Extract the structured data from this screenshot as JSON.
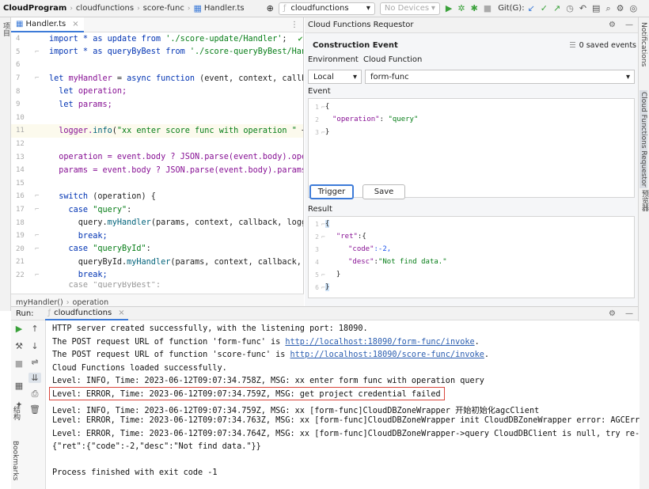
{
  "topbar": {
    "project": "CloudProgram",
    "crumbs": [
      "cloudfunctions",
      "score-func",
      "Handler.ts"
    ],
    "function_selector": "cloudfunctions",
    "devices": "No Devices",
    "git_label": "Git(G):"
  },
  "left_strip": {
    "label": "项目"
  },
  "right_strip": {
    "notifications": "Notifications",
    "requestor": "Cloud Functions Requestor",
    "preview": "预览器"
  },
  "editor": {
    "tab": "Handler.ts",
    "lines": [
      {
        "n": "4"
      },
      {
        "n": "5"
      },
      {
        "n": "6"
      },
      {
        "n": "7"
      },
      {
        "n": "8"
      },
      {
        "n": "9"
      },
      {
        "n": "10"
      },
      {
        "n": "11"
      },
      {
        "n": "12"
      },
      {
        "n": "13"
      },
      {
        "n": "14"
      },
      {
        "n": "15"
      },
      {
        "n": "16"
      },
      {
        "n": "17"
      },
      {
        "n": "18"
      },
      {
        "n": "19"
      },
      {
        "n": "20"
      },
      {
        "n": "21"
      },
      {
        "n": "22"
      }
    ],
    "code": {
      "l4a": "import * as update from ",
      "l4b": "'./score-update/Handler'",
      "l5a": "import * as queryByBest from ",
      "l5b": "'./score-queryByBest/Han",
      "l7a": "let ",
      "l7b": "myHandler",
      "l7c": " = ",
      "l7d": "async function",
      "l7e": " (event, context, callb",
      "l8a": "  let ",
      "l8b": "operation;",
      "l9a": "  let ",
      "l9b": "params;",
      "l11a": "  logger.",
      "l11b": "info",
      "l11c": "(",
      "l11d": "\"xx enter score func with operation \"",
      "l11e": " +",
      "l13": "  operation = event.body ? JSON.parse(event.body).ope",
      "l14": "  params = event.body ? JSON.parse(event.body).params",
      "l16a": "  switch ",
      "l16b": "(operation) {",
      "l17a": "    case ",
      "l17b": "\"query\"",
      "l17c": ":",
      "l18a": "      query.",
      "l18b": "myHandler",
      "l18c": "(params, context, callback, logg",
      "l19": "      break;",
      "l20a": "    case ",
      "l20b": "\"queryById\"",
      "l20c": ":",
      "l21a": "      queryById.",
      "l21b": "myHandler",
      "l21c": "(params, context, callback,",
      "l22": "      break;",
      "l23": "    case \"queryByBest\":"
    },
    "breadcrumb": [
      "myHandler()",
      "operation"
    ]
  },
  "cfr": {
    "title": "Cloud Functions Requestor",
    "construction_event": "Construction Event",
    "saved_events": "0 saved events",
    "environment_label": "Environment",
    "cloud_function_label": "Cloud Function",
    "environment_value": "Local",
    "function_value": "form-func",
    "event_label": "Event",
    "event_json": {
      "l1": "{",
      "key": "\"operation\"",
      "colon": ": ",
      "val": "\"query\"",
      "l3": "}"
    },
    "trigger": "Trigger",
    "save": "Save",
    "result_label": "Result",
    "result_json": {
      "l1": "{",
      "l2k": "\"ret\"",
      "l2v": ":{",
      "l3k": "\"code\"",
      "l3v": ":-2,",
      "l4k": "\"desc\"",
      "l4c": ":",
      "l4v": "\"Not find data.\"",
      "l5": "}",
      "l6": "}"
    },
    "line_numbers": [
      "1",
      "2",
      "3",
      "4",
      "5",
      "6"
    ]
  },
  "run": {
    "label": "Run:",
    "tab": "cloudfunctions",
    "console": {
      "c1": "HTTP server created successfully, with the listening port: 18090.",
      "c2a": "The POST request URL of function 'form-func' is ",
      "c2b": "http://localhost:18090/form-func/invoke",
      "c2c": ".",
      "c3a": "The POST request URL of function 'score-func' is ",
      "c3b": "http://localhost:18090/score-func/invoke",
      "c3c": ".",
      "c4": "Cloud Functions loaded successfully.",
      "c5": "Level: INFO, Time: 2023-06-12T09:07:34.758Z, MSG: xx enter form func with operation query",
      "c6": "Level: ERROR, Time: 2023-06-12T09:07:34.759Z, MSG: get project credential failed",
      "c7": "Level: INFO, Time: 2023-06-12T09:07:34.759Z, MSG: xx [form-func]CloudDBZoneWrapper 开始初始化agcClient",
      "c8": "Level: ERROR, Time: 2023-06-12T09:07:34.763Z, MSG: xx [form-func]CloudDBZoneWrapper init CloudDBZoneWrapper error: AGCError",
      "c9": "Level: ERROR, Time: 2023-06-12T09:07:34.764Z, MSG: xx [form-func]CloudDBZoneWrapper->query CloudDBClient is null, try re-in",
      "c10": "{\"ret\":{\"code\":-2,\"desc\":\"Not find data.\"}}",
      "c11": "Process finished with exit code -1"
    },
    "side_labels": {
      "structure": "结构",
      "bookmarks": "Bookmarks"
    }
  }
}
